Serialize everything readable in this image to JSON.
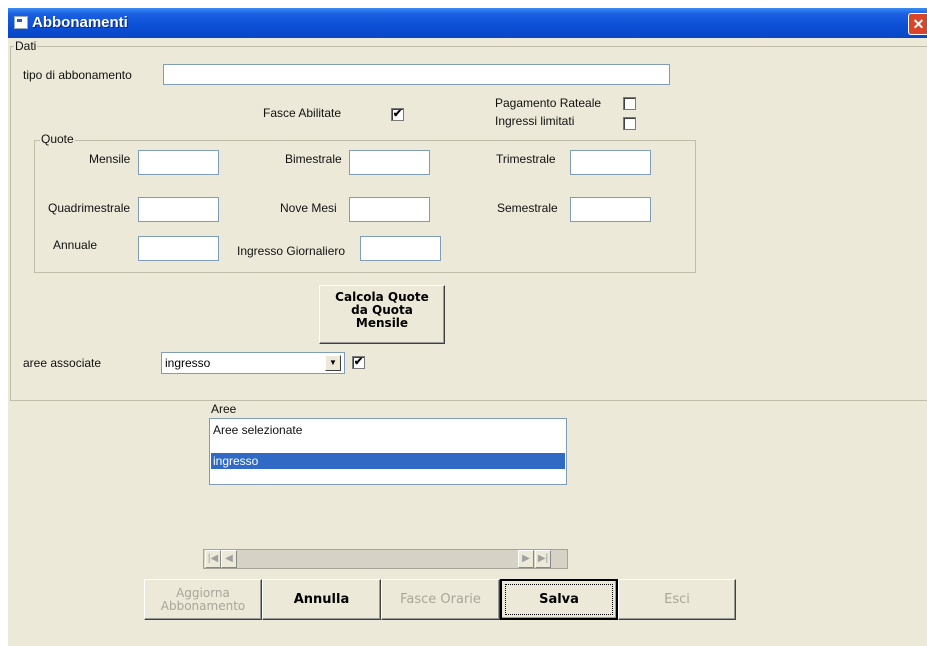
{
  "window": {
    "title": "Abbonamenti",
    "close_glyph": "✕"
  },
  "dati": {
    "group_label": "Dati",
    "tipo_label": "tipo di abbonamento",
    "tipo_value": "",
    "fasce_label": "Fasce Abilitate",
    "fasce_checked": true,
    "pagamento_label": "Pagamento Rateale",
    "pagamento_checked": false,
    "ingressi_label": "Ingressi limitati",
    "ingressi_checked": false
  },
  "quote": {
    "group_label": "Quote",
    "mensile": "Mensile",
    "bimestrale": "Bimestrale",
    "trimestrale": "Trimestrale",
    "quadrimestrale": "Quadrimestrale",
    "nove_mesi": "Nove Mesi",
    "semestrale": "Semestrale",
    "annuale": "Annuale",
    "giornaliero": "Ingresso Giornaliero"
  },
  "calcola_button": {
    "line1": "Calcola Quote",
    "line2": "da Quota",
    "line3": "Mensile"
  },
  "aree_associate": {
    "label": "aree associate",
    "selected": "ingresso",
    "checked": true,
    "check_glyph": "✔"
  },
  "aree": {
    "label": "Aree",
    "header": "Aree selezionate",
    "items": [
      "ingresso"
    ]
  },
  "navigator": {
    "first": "|◀",
    "prev": "◀",
    "next": "▶",
    "last": "▶|"
  },
  "buttons": {
    "aggiorna_line1": "Aggiorna",
    "aggiorna_line2": "Abbonamento",
    "annulla": "Annulla",
    "fasce_orarie": "Fasce Orarie",
    "salva": "Salva",
    "esci": "Esci"
  },
  "colors": {
    "titlebar": "#0b4fd6",
    "selection": "#316ac5",
    "dialog_bg": "#ece9d8"
  }
}
